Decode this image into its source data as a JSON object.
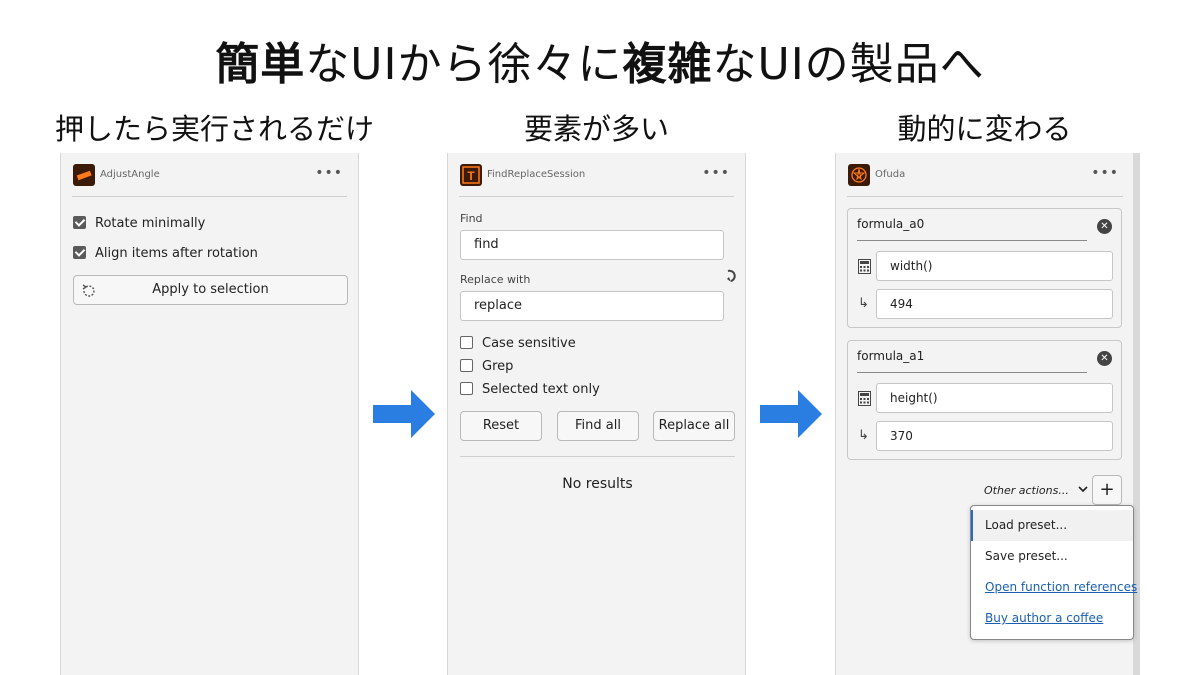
{
  "title": {
    "b1": "簡単",
    "t1": "なUIから徐々に",
    "b2": "複雑",
    "t2": "なUIの製品へ"
  },
  "columns": [
    {
      "heading": "押したら実行されるだけ"
    },
    {
      "heading": "要素が多い"
    },
    {
      "heading": "動的に変わる"
    }
  ],
  "panel1": {
    "app_name": "AdjustAngle",
    "more": "•••",
    "checks": [
      {
        "label": "Rotate minimally",
        "checked": true
      },
      {
        "label": "Align items after rotation",
        "checked": true
      }
    ],
    "apply_button": "Apply to selection",
    "apply_icon": "rotate-icon"
  },
  "panel2": {
    "app_name": "FindReplaceSession",
    "more": "•••",
    "find_label": "Find",
    "find_value": "find",
    "replace_label": "Replace with",
    "replace_value": "replace",
    "swap_icon": "swap-icon",
    "options": [
      {
        "label": "Case sensitive",
        "checked": false
      },
      {
        "label": "Grep",
        "checked": false
      },
      {
        "label": "Selected text only",
        "checked": false
      }
    ],
    "buttons": {
      "reset": "Reset",
      "find_all": "Find all",
      "replace_all": "Replace all"
    },
    "status": "No results"
  },
  "panel3": {
    "app_name": "Ofuda",
    "more": "•••",
    "formulas": [
      {
        "name": "formula_a0",
        "expr": "width()",
        "result": "494"
      },
      {
        "name": "formula_a1",
        "expr": "height()",
        "result": "370"
      }
    ],
    "other_actions": "Other actions...",
    "add": "+",
    "menu": [
      {
        "label": "Load preset...",
        "link": false
      },
      {
        "label": "Save preset...",
        "link": false
      },
      {
        "label": "Open function references",
        "link": true
      },
      {
        "label": "Buy author a coffee",
        "link": true
      }
    ]
  },
  "colors": {
    "arrow": "#2a7de1",
    "link": "#1a5fb4",
    "panel_bg": "#f3f3f3"
  }
}
